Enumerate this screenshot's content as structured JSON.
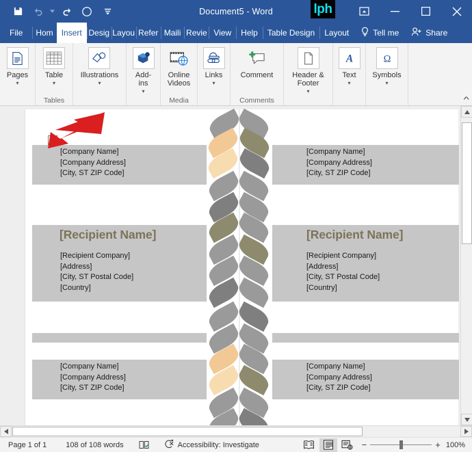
{
  "window": {
    "title": "Document5  -  Word",
    "logo_text": "lph",
    "quick_access": [
      {
        "name": "save",
        "label": "Save"
      },
      {
        "name": "undo",
        "label": "Undo"
      },
      {
        "name": "redo",
        "label": "Redo"
      },
      {
        "name": "autosave-circle",
        "label": "AutoSave"
      },
      {
        "name": "customize-quick-access-toolbar",
        "label": "Customize Quick Access Toolbar"
      }
    ],
    "controls": [
      {
        "name": "ribbon-display-options",
        "label": "Ribbon Display Options"
      },
      {
        "name": "minimize",
        "label": "Minimize"
      },
      {
        "name": "maximize",
        "label": "Maximize"
      },
      {
        "name": "close",
        "label": "Close"
      }
    ]
  },
  "tabs": [
    {
      "label": "File",
      "active": false,
      "clip": "file"
    },
    {
      "label": "Hom",
      "active": false,
      "clip": "clipped"
    },
    {
      "label": "Insert",
      "active": true,
      "clip": "none"
    },
    {
      "label": "Desig",
      "active": false,
      "clip": "clipped"
    },
    {
      "label": "Layou",
      "active": false,
      "clip": "clipped"
    },
    {
      "label": "Refer",
      "active": false,
      "clip": "clipped"
    },
    {
      "label": "Maili",
      "active": false,
      "clip": "clipped"
    },
    {
      "label": "Revie",
      "active": false,
      "clip": "clipped"
    },
    {
      "label": "View",
      "active": false,
      "clip": "none"
    },
    {
      "label": "Help",
      "active": false,
      "clip": "none"
    },
    {
      "label": "Table Design",
      "active": false,
      "clip": "none"
    },
    {
      "label": "Layout",
      "active": false,
      "clip": "none"
    }
  ],
  "tell_me": {
    "label": "Tell me",
    "icon": "lightbulb-icon"
  },
  "share": {
    "label": "Share",
    "icon": "share-person-icon"
  },
  "ribbon": {
    "groups": [
      {
        "name": "pages",
        "group_label": "",
        "items": [
          {
            "label": "Pages",
            "icon": "pages-icon",
            "caret": true
          }
        ]
      },
      {
        "name": "tables",
        "group_label": "Tables",
        "items": [
          {
            "label": "Table",
            "icon": "table-icon",
            "caret": true
          }
        ]
      },
      {
        "name": "illustrations",
        "group_label": "",
        "items": [
          {
            "label": "Illustrations",
            "icon": "illustrations-icon",
            "caret": true
          }
        ]
      },
      {
        "name": "add-ins",
        "group_label": "",
        "items": [
          {
            "label": "Add-ins",
            "icon": "addins-icon",
            "caret": true
          }
        ]
      },
      {
        "name": "media",
        "group_label": "Media",
        "items": [
          {
            "label": "Online Videos",
            "icon": "online-video-icon",
            "caret": false
          }
        ]
      },
      {
        "name": "links",
        "group_label": "",
        "items": [
          {
            "label": "Links",
            "icon": "links-icon",
            "caret": true
          }
        ]
      },
      {
        "name": "comments",
        "group_label": "Comments",
        "items": [
          {
            "label": "Comment",
            "icon": "comment-icon",
            "caret": false
          }
        ]
      },
      {
        "name": "header-footer",
        "group_label": "",
        "items": [
          {
            "label": "Header & Footer",
            "icon": "header-footer-icon",
            "caret": true
          }
        ]
      },
      {
        "name": "text",
        "group_label": "",
        "items": [
          {
            "label": "Text",
            "icon": "text-icon",
            "caret": true
          }
        ]
      },
      {
        "name": "symbols",
        "group_label": "",
        "items": [
          {
            "label": "Symbols",
            "icon": "omega-icon",
            "caret": true
          }
        ]
      }
    ],
    "collapse_label": "Collapse the Ribbon"
  },
  "document": {
    "blocks": [
      {
        "name": "company-block-top-left",
        "lines": [
          "[Company Name]",
          "[Company Address]",
          "[City, ST  ZIP Code]"
        ]
      },
      {
        "name": "company-block-top-right",
        "lines": [
          "[Company Name]",
          "[Company Address]",
          "[City, ST  ZIP Code]"
        ]
      },
      {
        "name": "recipient-block-left",
        "heading": "[Recipient Name]",
        "lines": [
          "[Recipient Company]",
          "[Address]",
          "[City, ST  Postal Code]",
          "[Country]"
        ]
      },
      {
        "name": "recipient-block-right",
        "heading": "[Recipient Name]",
        "lines": [
          "[Recipient Company]",
          "[Address]",
          "[City, ST  Postal Code]",
          "[Country]"
        ]
      },
      {
        "name": "company-block-bottom-left",
        "lines": [
          "[Company Name]",
          "[Company Address]",
          "[City, ST  ZIP Code]"
        ]
      },
      {
        "name": "company-block-bottom-right",
        "lines": [
          "[Company Name]",
          "[Company Address]",
          "[City, ST  ZIP Code]"
        ]
      }
    ],
    "table_move_handle": {
      "name": "table-move-handle",
      "glyph": "✛"
    },
    "annotation_arrow": {
      "name": "red-arrow-annotation",
      "color": "#d91f1f"
    },
    "colors": {
      "heading": "#7d7259",
      "shading": "#c6c6c6",
      "leaf_gray": "#9a9a9a",
      "leaf_dark_gray": "#7f7f7f",
      "leaf_olive": "#8d8a6e",
      "leaf_tan": "#f2c894",
      "leaf_light_tan": "#f7dcb0"
    }
  },
  "status": {
    "page": "Page 1 of 1",
    "words": "108 of 108 words",
    "proofing_icon": "proofing-icon",
    "accessibility": "Accessibility: Investigate",
    "view_buttons": [
      {
        "name": "read-mode",
        "label": "Read Mode",
        "active": false
      },
      {
        "name": "print-layout",
        "label": "Print Layout",
        "active": true
      },
      {
        "name": "web-layout",
        "label": "Web Layout",
        "active": false
      }
    ],
    "zoom_out": "−",
    "zoom_in": "+",
    "zoom_level": "100%"
  }
}
